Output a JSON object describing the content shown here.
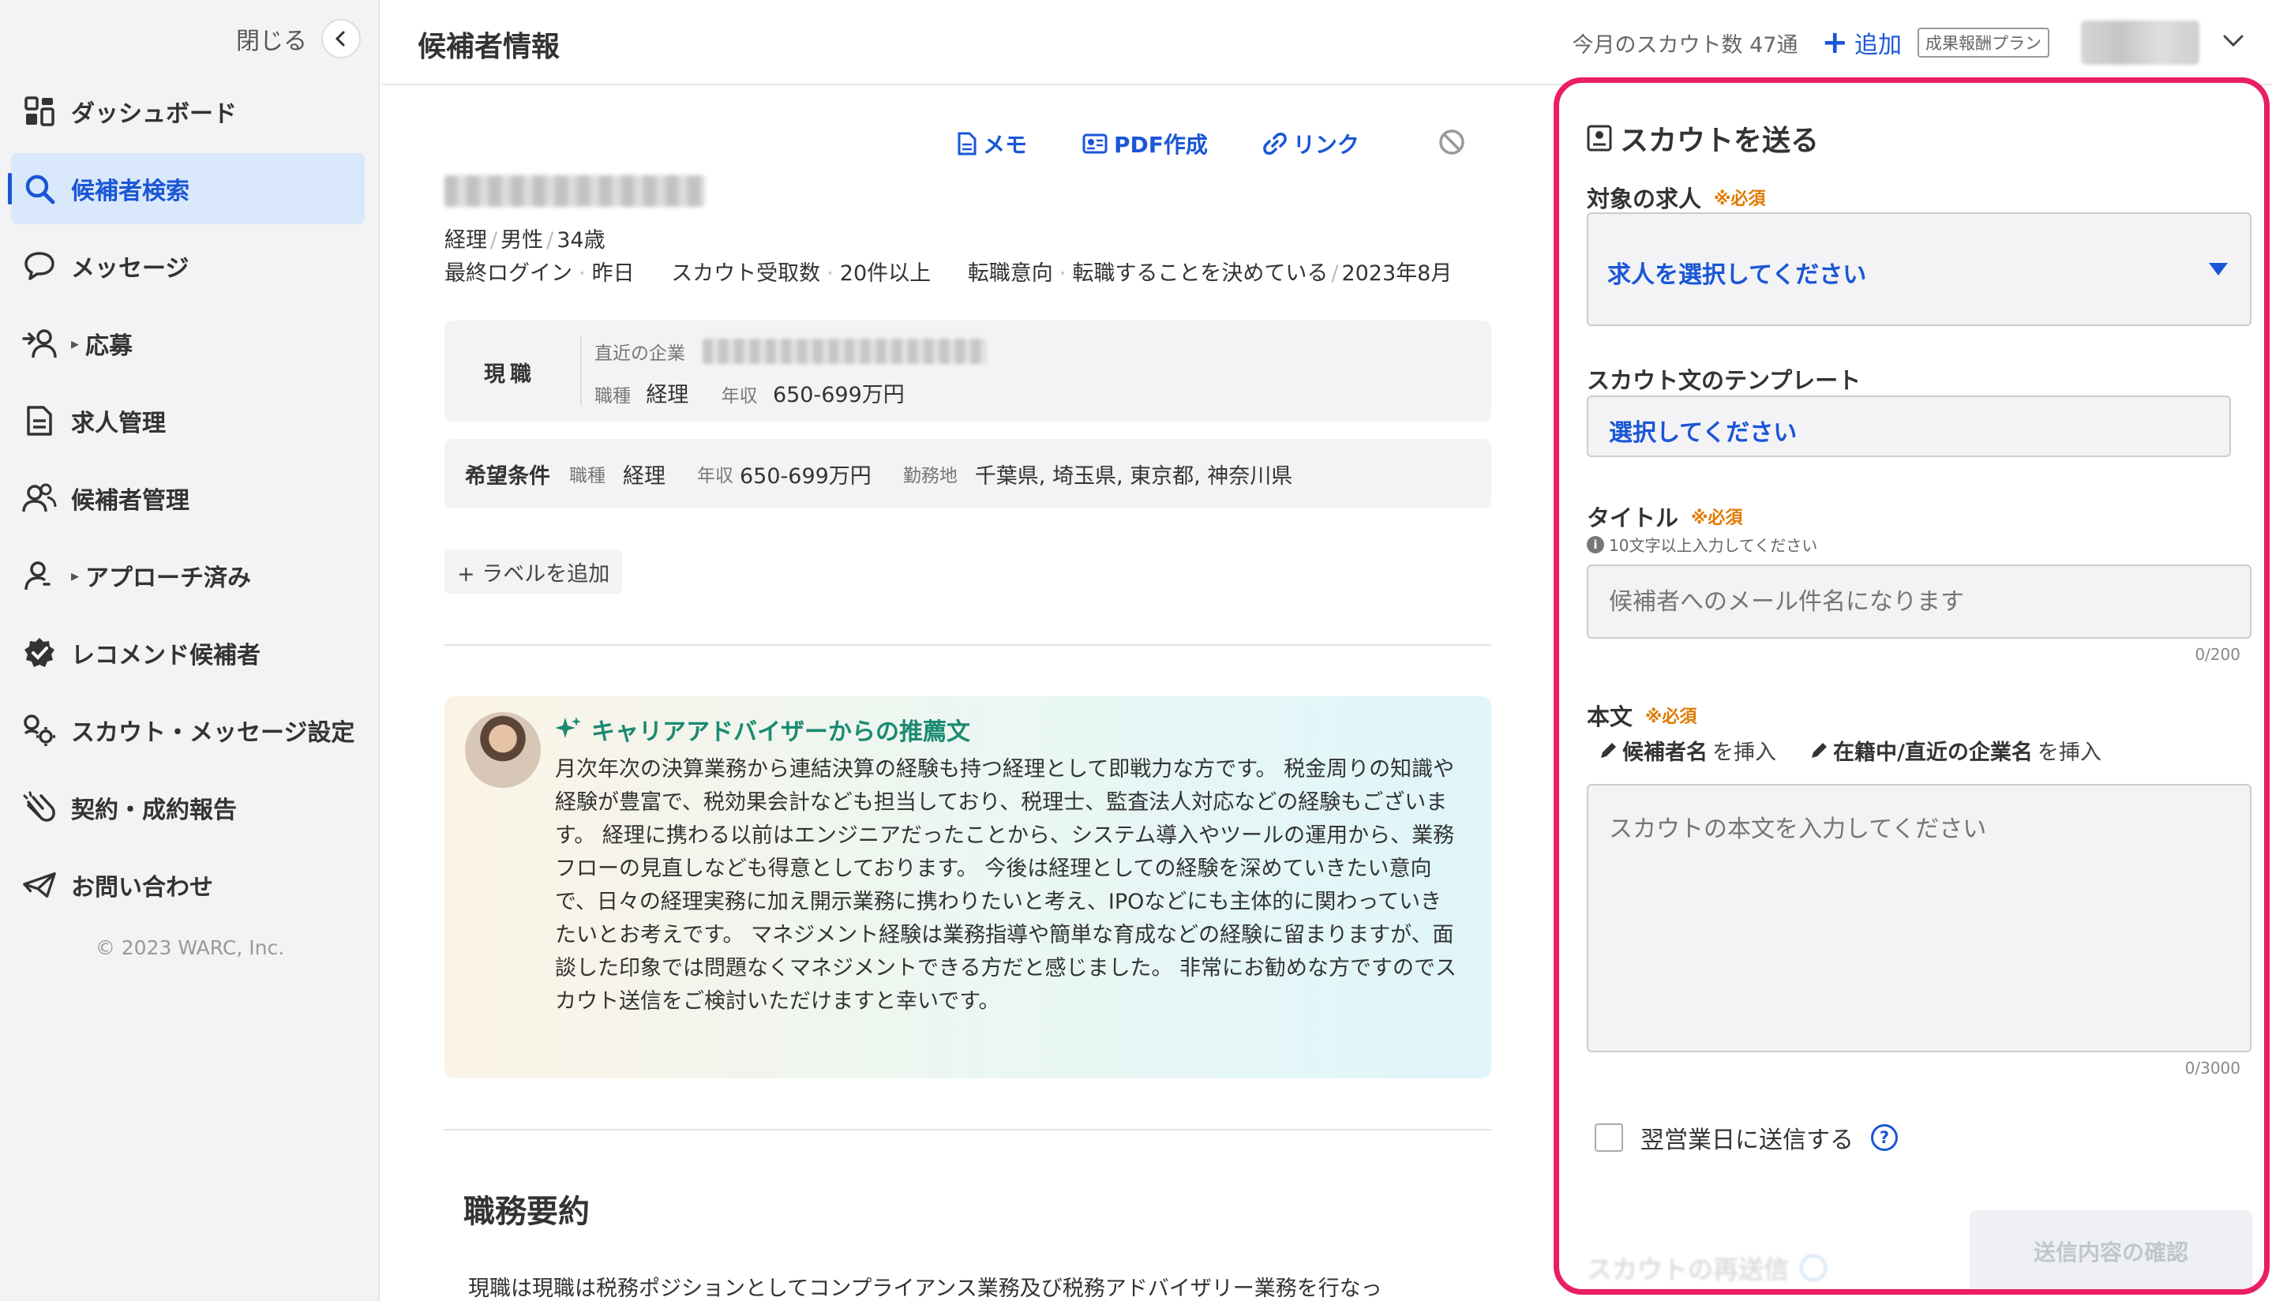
{
  "sidebar": {
    "close_label": "閉じる",
    "items": [
      {
        "label": "ダッシュボード"
      },
      {
        "label": "候補者検索"
      },
      {
        "label": "メッセージ"
      },
      {
        "label": "応募"
      },
      {
        "label": "求人管理"
      },
      {
        "label": "候補者管理"
      },
      {
        "label": "アプローチ済み"
      },
      {
        "label": "レコメンド候補者"
      },
      {
        "label": "スカウト・メッセージ設定"
      },
      {
        "label": "契約・成約報告"
      },
      {
        "label": "お問い合わせ"
      }
    ],
    "active_index": 1,
    "copyright": "© 2023 WARC, Inc."
  },
  "header": {
    "title": "候補者情報",
    "scout_count": "今月のスカウト数 47通",
    "add_plus": "+",
    "add_label": "追加",
    "plan_badge": "成果報酬プラン"
  },
  "candidate": {
    "actions": {
      "memo": "メモ",
      "pdf": "PDF作成",
      "link": "リンク"
    },
    "meta": {
      "job": "経理",
      "gender": "男性",
      "age": "34歳"
    },
    "login_label": "最終ログイン",
    "login_value": "昨日",
    "scouts_label": "スカウト受取数",
    "scouts_value": "20件以上",
    "intent_label": "転職意向",
    "intent_value": "転職することを決めている",
    "intent_date": "2023年8月",
    "current": {
      "label": "現職",
      "company_label": "直近の企業",
      "job_label": "職種",
      "job_value": "経理",
      "salary_label": "年収",
      "salary_value": "650-699万円"
    },
    "desired": {
      "label": "希望条件",
      "job_label": "職種",
      "job_value": "経理",
      "salary_label": "年収",
      "salary_value": "650-699万円",
      "location_label": "勤務地",
      "location_value": "千葉県, 埼玉県, 東京都, 神奈川県"
    },
    "add_label": "+ ラベルを追加",
    "recommendation": {
      "title": "キャリアアドバイザーからの推薦文",
      "text": "月次年次の決算業務から連結決算の経験も持つ経理として即戦力な方です。 税金周りの知識や経験が豊富で、税効果会計なども担当しており、税理士、監査法人対応などの経験もございます。 経理に携わる以前はエンジニアだったことから、システム導入やツールの運用から、業務フローの見直しなども得意としております。 今後は経理としての経験を深めていきたい意向で、日々の経理実務に加え開示業務に携わりたいと考え、IPOなどにも主体的に関わっていきたいとお考えです。 マネジメント経験は業務指導や簡単な育成などの経験に留まりますが、面談した印象では問題なくマネジメントできる方だと感じました。 非常にお勧めな方ですのでスカウト送信をご検討いただけますと幸いです。"
    },
    "summary_title": "職務要約",
    "summary_text": "現職は現職は税務ポジションとしてコンプライアンス業務及び税務アドバイザリー業務を行なっ"
  },
  "scout_panel": {
    "title": "スカウトを送る",
    "required_mark": "※必須",
    "job_label": "対象の求人",
    "job_placeholder": "求人を選択してください",
    "template_label": "スカウト文のテンプレート",
    "template_placeholder": "選択してください",
    "title_label": "タイトル",
    "title_hint": "10文字以上入力してください",
    "title_placeholder": "候補者へのメール件名になります",
    "title_counter": "0/200",
    "body_label": "本文",
    "insert_candidate_bold": "候補者名",
    "insert_company_bold": "在籍中/直近の企業名",
    "insert_suffix": "を挿入",
    "body_placeholder": "スカウトの本文を入力してください",
    "body_counter": "0/3000",
    "next_day_label": "翌営業日に送信する",
    "resend_label": "スカウトの再送信",
    "confirm_label": "送信内容の確認"
  },
  "colors": {
    "accent": "#1a56d6",
    "highlight_border": "#e91e63",
    "required": "#e07a00",
    "recommend_title": "#1b8a72"
  }
}
